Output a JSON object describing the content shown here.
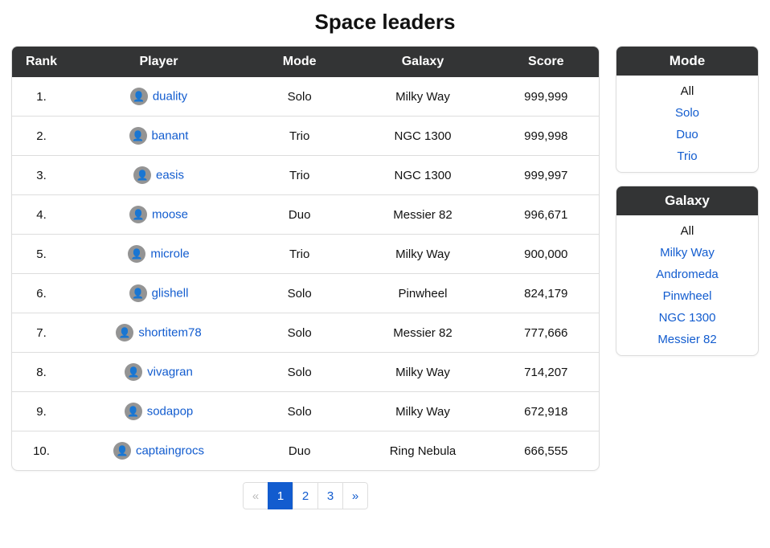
{
  "title": "Space leaders",
  "columns": {
    "rank": "Rank",
    "player": "Player",
    "mode": "Mode",
    "galaxy": "Galaxy",
    "score": "Score"
  },
  "rows": [
    {
      "rank": "1.",
      "player": "duality",
      "mode": "Solo",
      "galaxy": "Milky Way",
      "score": "999,999"
    },
    {
      "rank": "2.",
      "player": "banant",
      "mode": "Trio",
      "galaxy": "NGC 1300",
      "score": "999,998"
    },
    {
      "rank": "3.",
      "player": "easis",
      "mode": "Trio",
      "galaxy": "NGC 1300",
      "score": "999,997"
    },
    {
      "rank": "4.",
      "player": "moose",
      "mode": "Duo",
      "galaxy": "Messier 82",
      "score": "996,671"
    },
    {
      "rank": "5.",
      "player": "microle",
      "mode": "Trio",
      "galaxy": "Milky Way",
      "score": "900,000"
    },
    {
      "rank": "6.",
      "player": "glishell",
      "mode": "Solo",
      "galaxy": "Pinwheel",
      "score": "824,179"
    },
    {
      "rank": "7.",
      "player": "shortitem78",
      "mode": "Solo",
      "galaxy": "Messier 82",
      "score": "777,666"
    },
    {
      "rank": "8.",
      "player": "vivagran",
      "mode": "Solo",
      "galaxy": "Milky Way",
      "score": "714,207"
    },
    {
      "rank": "9.",
      "player": "sodapop",
      "mode": "Solo",
      "galaxy": "Milky Way",
      "score": "672,918"
    },
    {
      "rank": "10.",
      "player": "captaingrocs",
      "mode": "Duo",
      "galaxy": "Ring Nebula",
      "score": "666,555"
    }
  ],
  "pagination": {
    "prev_glyph": "«",
    "next_glyph": "»",
    "pages": [
      "1",
      "2",
      "3"
    ],
    "active_index": 0
  },
  "filters": {
    "mode": {
      "title": "Mode",
      "items": [
        "All",
        "Solo",
        "Duo",
        "Trio"
      ],
      "active_index": 0
    },
    "galaxy": {
      "title": "Galaxy",
      "items": [
        "All",
        "Milky Way",
        "Andromeda",
        "Pinwheel",
        "NGC 1300",
        "Messier 82"
      ],
      "active_index": 0
    }
  },
  "avatar_glyph": "👤"
}
